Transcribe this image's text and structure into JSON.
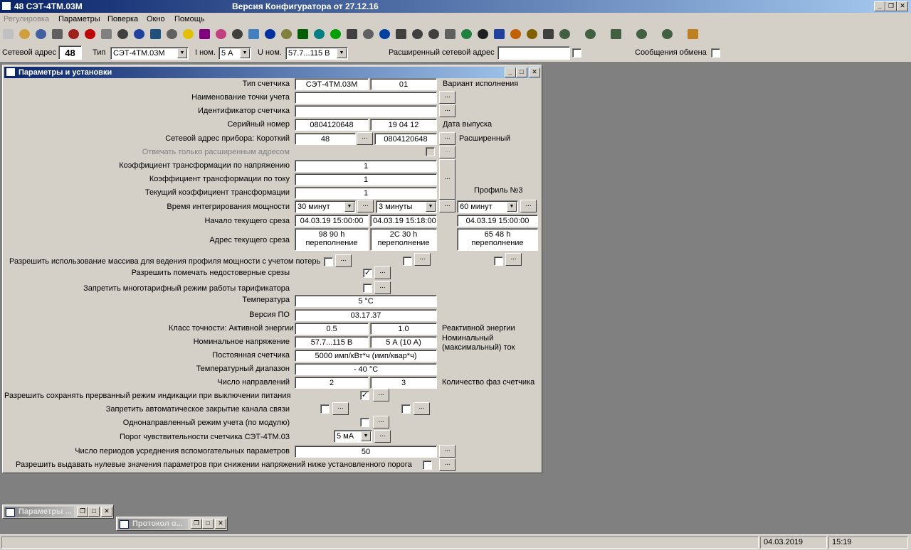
{
  "window": {
    "title_app": "48  СЭТ-4ТМ.03М",
    "title_version": "Версия Конфигуратора  от 27.12.16"
  },
  "menu": [
    "Регулировка",
    "Параметры",
    "Поверка",
    "Окно",
    "Помощь"
  ],
  "toolbar_icons": [
    "new-icon",
    "open-icon",
    "save-icon",
    "print-icon",
    "read-icon",
    "stop-icon",
    "copy-icon",
    "phone-icon",
    "wave-icon",
    "chart-icon",
    "clock-icon",
    "bulb-icon",
    "bars-icon",
    "palette-icon",
    "meter-icon",
    "window-icon",
    "info-icon",
    "list-icon",
    "screen-icon",
    "eye-icon",
    "check-icon",
    "scales-icon",
    "device-icon",
    "radar-icon",
    "timer-icon",
    "delta-icon",
    "scissors-icon",
    "tools-icon",
    "globe-icon",
    "sigma-icon",
    "book-icon",
    "fire-icon",
    "pen-icon",
    "monitor-icon",
    "plug1-icon",
    "plug2-icon",
    "plug3-icon",
    "plug4-icon",
    "plug5-icon",
    "paint-icon"
  ],
  "addrbar": {
    "net_addr_label": "Сетевой адрес",
    "net_addr": "48",
    "type_label": "Тип",
    "type_value": "СЭТ-4ТМ.03М",
    "inom_label": "I ном.",
    "inom_value": "5 А",
    "unom_label": "U ном.",
    "unom_value": "57.7...115 В",
    "ext_addr_label": "Расширенный сетевой адрес",
    "ext_addr": "",
    "exchange_label": "Сообщения обмена"
  },
  "child": {
    "title": "Параметры и установки"
  },
  "form": {
    "type_label": "Тип счетчика",
    "type_value": "СЭТ-4ТМ.03М",
    "variant_value": "01",
    "variant_label": "Вариант исполнения",
    "point_label": "Наименование точки учета",
    "point_value": "",
    "ident_label": "Идентификатор счетчика",
    "ident_value": "",
    "serial_label": "Серийный номер",
    "serial_value": "0804120648",
    "date_value": "19 04 12",
    "date_label": "Дата выпуска",
    "netaddr_label": "Сетевой адрес прибора: Короткий",
    "netaddr_short": "48",
    "netaddr_ext": "0804120648",
    "netaddr_ext_label": "Расширенный",
    "ext_only_label": "Отвечать только расширенным адресом",
    "ktu_label": "Коэффициент трансформации по напряжению",
    "ktu_value": "1",
    "kti_label": "Коэффициент трансформации по току",
    "kti_value": "1",
    "kt_label": "Текущий коэффициент трансформации",
    "kt_value": "1",
    "profile3_label": "Профиль №3",
    "integr_label": "Время интегрирования мощности",
    "integr1": "30 минут",
    "integr2": "3 минуты",
    "integr3": "60 минут",
    "slice_start_label": "Начало текущего среза",
    "slice1": "04.03.19 15:00:00",
    "slice2": "04.03.19 15:18:00",
    "slice3": "04.03.19 15:00:00",
    "slice_addr_label": "Адрес текущего среза",
    "addr1_a": "98 90  h",
    "addr1_b": "переполнение",
    "addr2_a": "2C 30  h",
    "addr2_b": "переполнение",
    "addr3_a": "65 48  h",
    "addr3_b": "переполнение",
    "array_label": "Разрешить использование массива для ведения профиля мощности с учетом потерь",
    "unreliable_label": "Разрешить помечать недостоверные срезы",
    "multitariff_label": "Запретить многотарифный режим работы тарификатора",
    "temp_label": "Температура",
    "temp_value": "5 °C",
    "sw_label": "Версия ПО",
    "sw_value": "03.17.37",
    "accuracy_label": "Класс точности: Активной энергии",
    "acc_active": "0.5",
    "acc_reactive": "1.0",
    "reactive_label": "Реактивной энергии",
    "unom_label": "Номинальное напряжение",
    "unom_value": "57.7...115 В",
    "inom_value": "5 А (10 А)",
    "inom_label1": "Номинальный",
    "inom_label2": "(максимальный) ток",
    "const_label": "Постоянная счетчика",
    "const_value": "5000 имп/кВт*ч (имп/квар*ч)",
    "trange_label": "Температурный диапазон",
    "trange_value": "- 40 °C",
    "dirs_label": "Число направлений",
    "dirs_value": "2",
    "phases_value": "3",
    "phases_label": "Количество фаз счетчика",
    "save_ind_label": "Разрешить сохранять прерванный режим индикации при выключении питания",
    "autoclose_label": "Запретить автоматическое закрытие канала связи",
    "unidir_label": "Однонаправленный режим учета (по модулю)",
    "threshold_label": "Порог чувствительности счетчика СЭТ-4ТМ.03",
    "threshold_value": "5 мА",
    "periods_label": "Число периодов усреднения вспомогательных параметров",
    "periods_value": "50",
    "zero_label": "Разрешить выдавать нулевые значения параметров при снижении напряжений ниже установленного порога",
    "dots": "..."
  },
  "minimized": [
    {
      "title": "Параметры ..."
    },
    {
      "title": "Протокол о..."
    }
  ],
  "status": {
    "date": "04.03.2019",
    "time": "15:19"
  }
}
